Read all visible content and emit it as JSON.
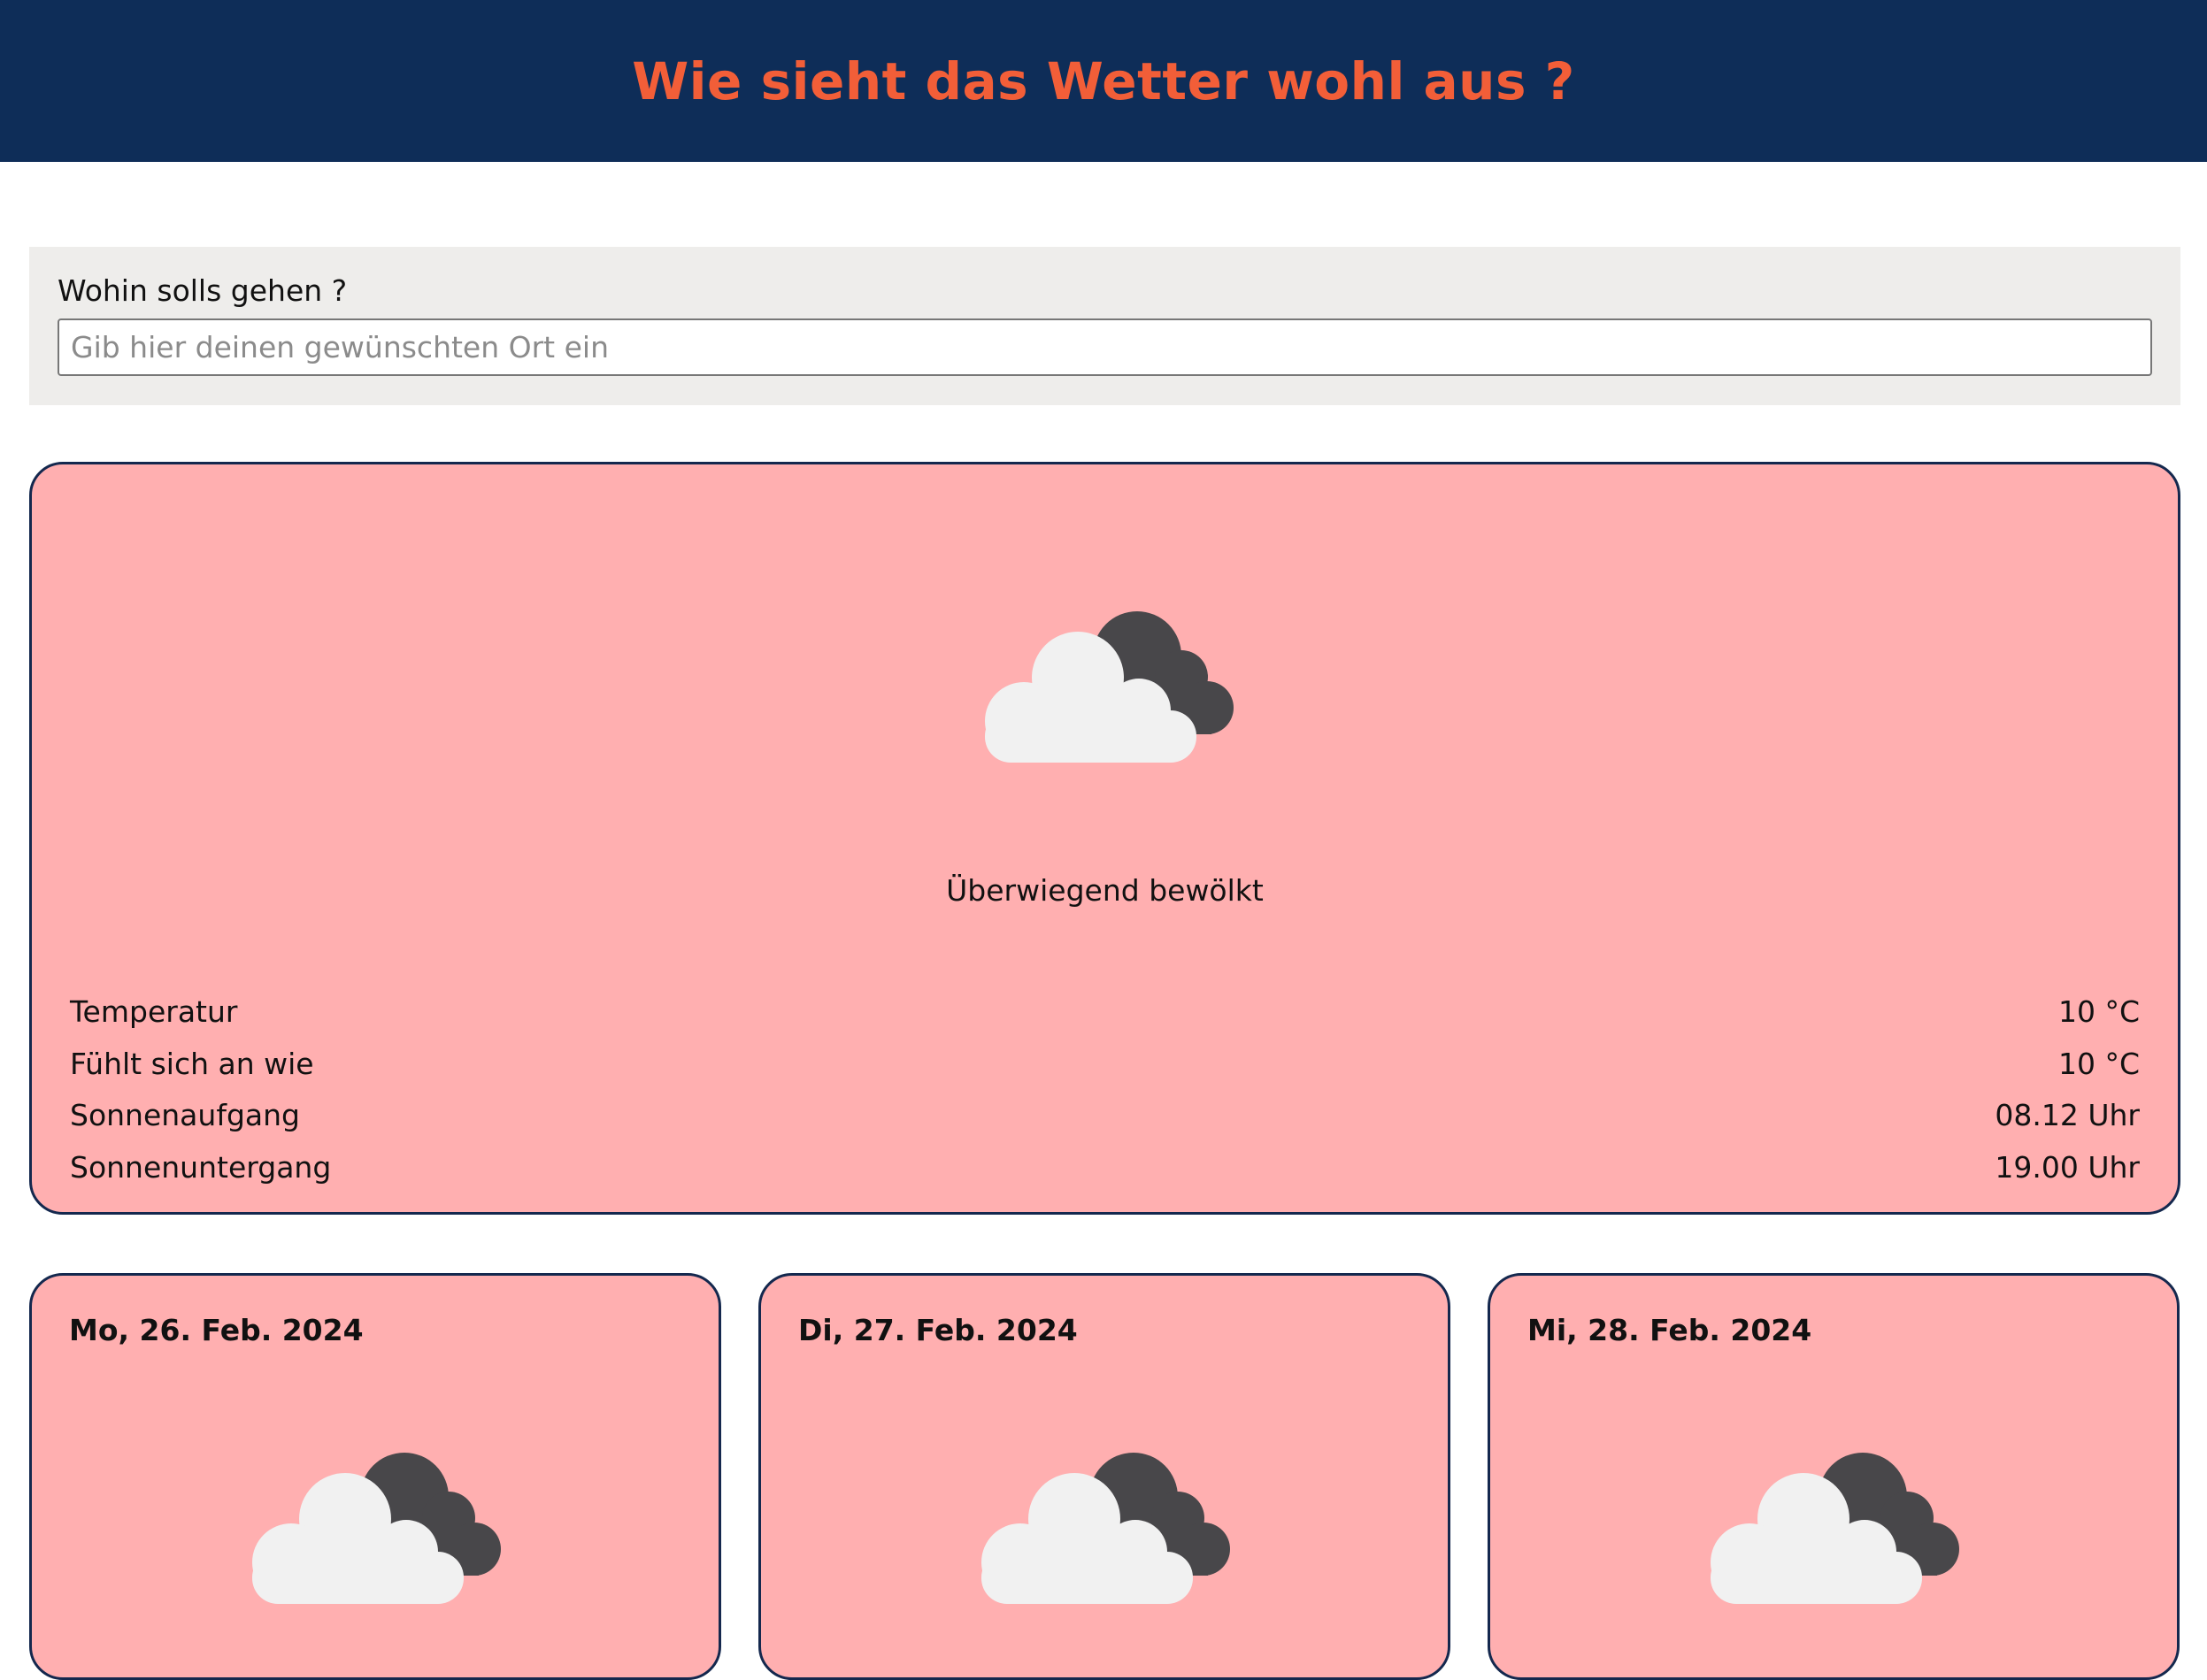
{
  "header": {
    "title": "Wie sieht das Wetter wohl aus ?"
  },
  "search": {
    "label": "Wohin solls gehen ?",
    "placeholder": "Gib hier deinen gewünschten Ort ein",
    "value": ""
  },
  "current": {
    "icon": "partly-cloudy-icon",
    "condition": "Überwiegend bewölkt",
    "stats": [
      {
        "label": "Temperatur",
        "value": "10 °C"
      },
      {
        "label": "Fühlt sich an wie",
        "value": "10 °C"
      },
      {
        "label": "Sonnenaufgang",
        "value": "08.12 Uhr"
      },
      {
        "label": "Sonnenuntergang",
        "value": "19.00 Uhr"
      }
    ]
  },
  "forecast": [
    {
      "date": "Mo, 26. Feb. 2024",
      "icon": "partly-cloudy-icon"
    },
    {
      "date": "Di, 27. Feb. 2024",
      "icon": "partly-cloudy-icon"
    },
    {
      "date": "Mi, 28. Feb. 2024",
      "icon": "partly-cloudy-icon"
    }
  ],
  "colors": {
    "header_bg": "#0e2d58",
    "title": "#f25e38",
    "card_bg": "#ffafb0",
    "card_border": "#14284e",
    "search_panel_bg": "#eeedeb",
    "cloud_light": "#f1f1f1",
    "cloud_dark": "#48474a"
  }
}
